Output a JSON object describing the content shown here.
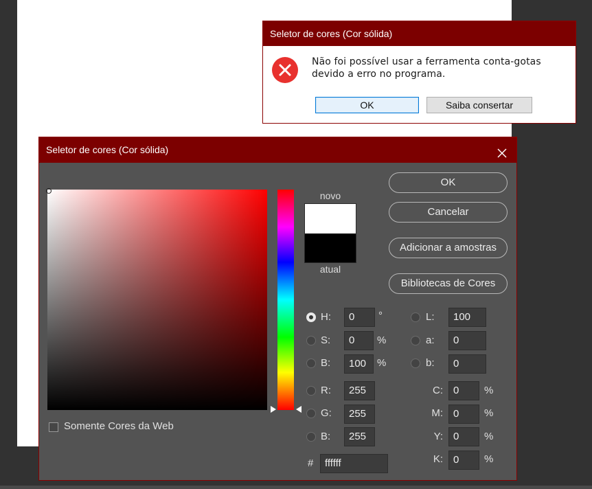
{
  "error_dialog": {
    "title": "Seletor de cores (Cor sólida)",
    "icon": "error-icon",
    "message": "Não foi possível usar a ferramenta conta-gotas devido a erro no programa.",
    "ok_label": "OK",
    "help_label": "Saiba consertar"
  },
  "color_picker": {
    "title": "Seletor de cores (Cor sólida)",
    "close_icon": "close-icon",
    "new_label": "novo",
    "current_label": "atual",
    "new_color": "#ffffff",
    "current_color": "#000000",
    "buttons": {
      "ok": "OK",
      "cancel": "Cancelar",
      "add_swatches": "Adicionar a amostras",
      "libraries": "Bibliotecas de Cores"
    },
    "web_only_label": "Somente Cores da Web",
    "hsb": {
      "h_label": "H:",
      "h_value": "0",
      "h_unit": "°",
      "s_label": "S:",
      "s_value": "0",
      "s_unit": "%",
      "b_label": "B:",
      "b_value": "100",
      "b_unit": "%"
    },
    "rgb": {
      "r_label": "R:",
      "r_value": "255",
      "g_label": "G:",
      "g_value": "255",
      "b_label": "B:",
      "b_value": "255"
    },
    "lab": {
      "l_label": "L:",
      "l_value": "100",
      "a_label": "a:",
      "a_value": "0",
      "b_label": "b:",
      "b_value": "0"
    },
    "cmyk": {
      "c_label": "C:",
      "c_value": "0",
      "m_label": "M:",
      "m_value": "0",
      "y_label": "Y:",
      "y_value": "0",
      "k_label": "K:",
      "k_value": "0",
      "unit": "%"
    },
    "hex_label": "#",
    "hex_value": "ffffff",
    "hue_degrees": 0
  },
  "colors": {
    "title_bar": "#7c0000",
    "dialog_bg": "#535353",
    "error_red": "#e8312e"
  }
}
